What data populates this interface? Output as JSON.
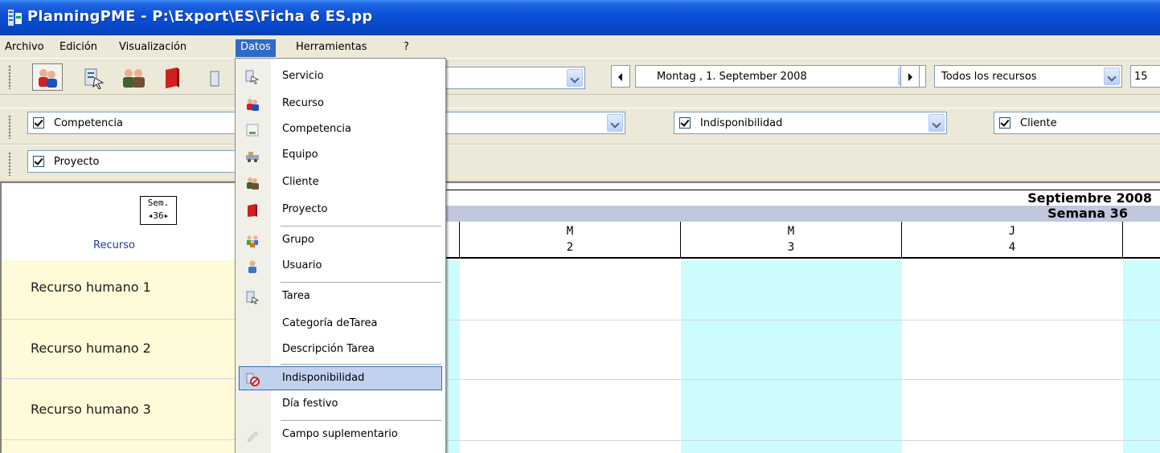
{
  "window": {
    "title": "PlanningPME - P:\\Export\\ES\\Ficha 6 ES.pp"
  },
  "menubar": {
    "items": [
      "Archivo",
      "Edición",
      "Visualización",
      "Datos",
      "Herramientas",
      "?"
    ],
    "active": "Datos"
  },
  "toolbar1": {
    "date_value": "Montag  ,  1. September 2008",
    "resource_filter": "Todos los recursos",
    "zoom_value": "15"
  },
  "toolbar2": {
    "filters": [
      "Competencia",
      "Indisponibilidad",
      "Cliente"
    ]
  },
  "toolbar3": {
    "filters": [
      "Proyecto"
    ]
  },
  "planning": {
    "week_box_title": "Sem.",
    "week_box_nav": "◂36▸",
    "resource_header": "Recurso",
    "month_label": "Septiembre 2008",
    "week_label": "Semana 36",
    "days": [
      {
        "letter": "M",
        "number": "2"
      },
      {
        "letter": "M",
        "number": "3"
      },
      {
        "letter": "J",
        "number": "4"
      }
    ],
    "resources": [
      "Recurso humano 1",
      "Recurso humano 2",
      "Recurso humano 3"
    ]
  },
  "datos_menu": {
    "items": [
      {
        "label": "Servicio",
        "icon": "service-icon"
      },
      {
        "label": "Recurso",
        "icon": "resource-people-icon"
      },
      {
        "label": "Competencia",
        "icon": "skill-icon"
      },
      {
        "label": "Equipo",
        "icon": "equipment-icon"
      },
      {
        "label": "Cliente",
        "icon": "client-icon"
      },
      {
        "label": "Proyecto",
        "icon": "project-book-icon"
      },
      {
        "label": "Grupo",
        "icon": "group-icon"
      },
      {
        "label": "Usuario",
        "icon": "user-icon"
      },
      {
        "label": "Tarea",
        "icon": "task-icon"
      },
      {
        "label": "Categoría deTarea",
        "icon": ""
      },
      {
        "label": "Descripción Tarea",
        "icon": ""
      },
      {
        "label": "Indisponibilidad",
        "icon": "unavailability-icon"
      },
      {
        "label": "Día festivo",
        "icon": ""
      },
      {
        "label": "Campo suplementario",
        "icon": "extra-field-icon"
      }
    ],
    "highlighted": "Indisponibilidad"
  },
  "colors": {
    "title_bar": "#0a4fd6",
    "menu_highlight": "#316ac5",
    "resource_row_bg": "#fffbd8",
    "weekend_col_bg": "#ccfcfc",
    "week_header_bg": "#c0c8e0"
  }
}
